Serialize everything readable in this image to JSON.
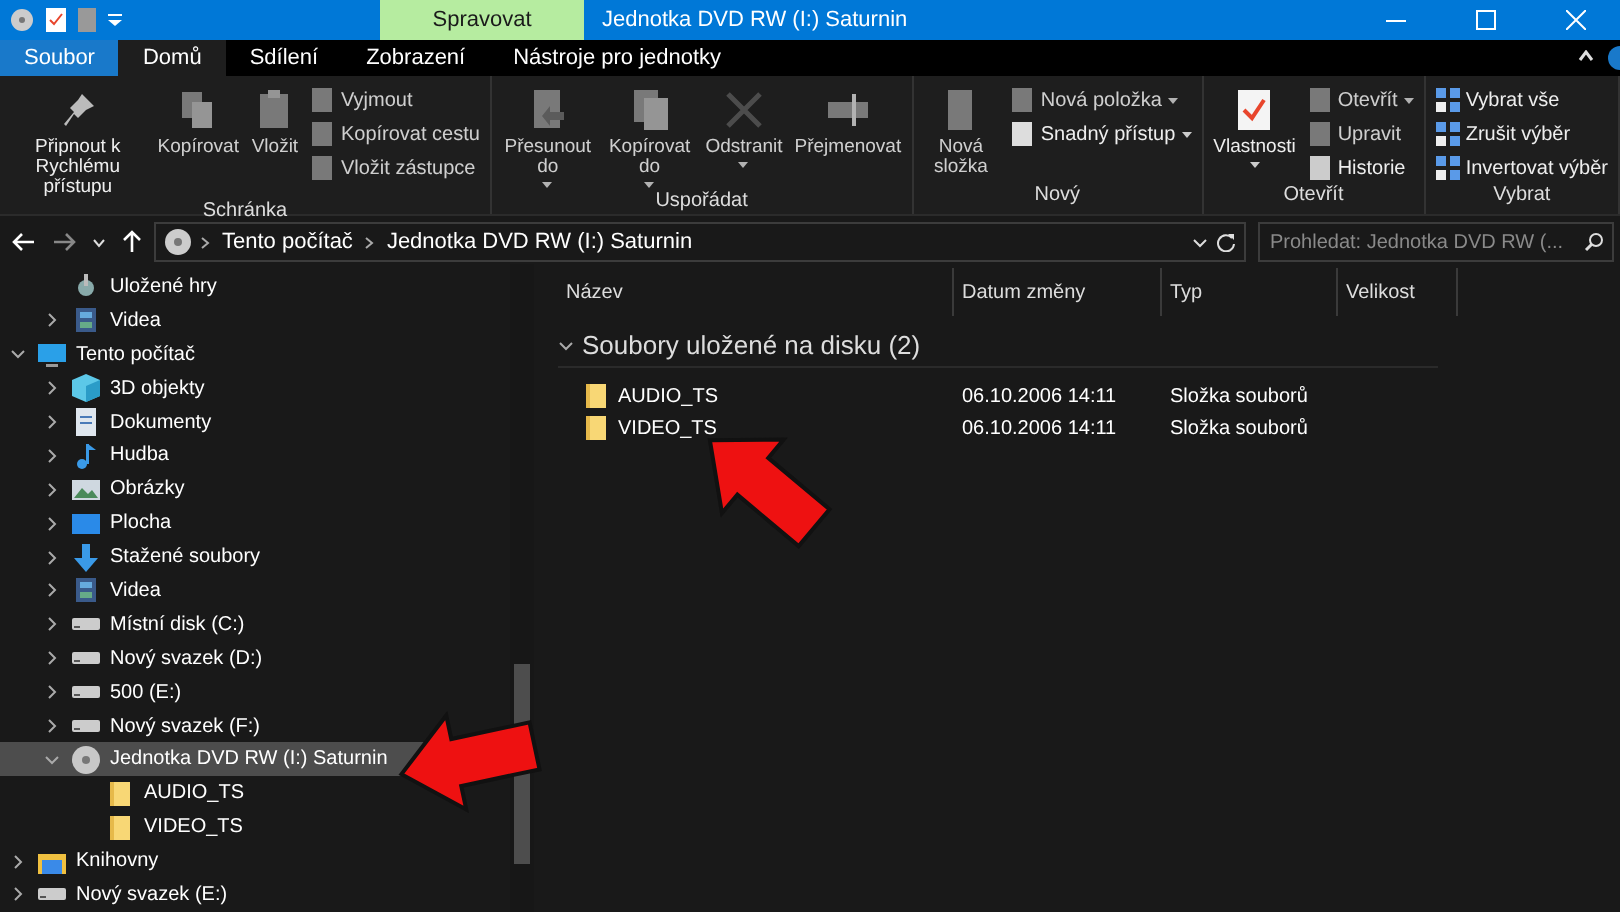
{
  "title_bar": {
    "context_tab": "Spravovat",
    "title": "Jednotka DVD RW (I:) Saturnin"
  },
  "ribbon_tabs": [
    {
      "label": "Soubor",
      "kind": "file",
      "selected": false
    },
    {
      "label": "Domů",
      "kind": "tab",
      "selected": true
    },
    {
      "label": "Sdílení",
      "kind": "tab",
      "selected": false
    },
    {
      "label": "Zobrazení",
      "kind": "tab",
      "selected": false
    },
    {
      "label": "Nástroje pro jednotky",
      "kind": "tab",
      "selected": false
    }
  ],
  "ribbon_groups": [
    {
      "label": "Schránka",
      "items": [
        {
          "kind": "large",
          "label": "Připnout k Rychlému přístupu",
          "disabled": false
        },
        {
          "kind": "large",
          "label": "Kopírovat",
          "disabled": true
        },
        {
          "kind": "large",
          "label": "Vložit",
          "disabled": true
        },
        {
          "kind": "stack",
          "items": [
            {
              "label": "Vyjmout",
              "disabled": true
            },
            {
              "label": "Kopírovat cestu",
              "disabled": true
            },
            {
              "label": "Vložit zástupce",
              "disabled": true
            }
          ]
        }
      ]
    },
    {
      "label": "Uspořádat",
      "items": [
        {
          "kind": "large",
          "label": "Přesunout do",
          "disabled": true,
          "menu": true
        },
        {
          "kind": "large",
          "label": "Kopírovat do",
          "disabled": true,
          "menu": true
        },
        {
          "kind": "large",
          "label": "Odstranit",
          "disabled": true,
          "menu": true
        },
        {
          "kind": "large",
          "label": "Přejmenovat",
          "disabled": true
        }
      ]
    },
    {
      "label": "Nový",
      "items": [
        {
          "kind": "large",
          "label": "Nová složka",
          "disabled": true
        },
        {
          "kind": "stack",
          "items": [
            {
              "label": "Nová položka",
              "disabled": true,
              "menu": true
            },
            {
              "label": "Snadný přístup",
              "disabled": false,
              "menu": true
            }
          ]
        }
      ]
    },
    {
      "label": "Otevřít",
      "items": [
        {
          "kind": "large",
          "label": "Vlastnosti",
          "disabled": false,
          "menu": true
        },
        {
          "kind": "stack",
          "items": [
            {
              "label": "Otevřít",
              "disabled": true,
              "menu": true
            },
            {
              "label": "Upravit",
              "disabled": true
            },
            {
              "label": "Historie",
              "disabled": false
            }
          ]
        }
      ]
    },
    {
      "label": "Vybrat",
      "items": [
        {
          "kind": "stack",
          "items": [
            {
              "label": "Vybrat vše",
              "disabled": false
            },
            {
              "label": "Zrušit výběr",
              "disabled": false
            },
            {
              "label": "Invertovat výběr",
              "disabled": false
            }
          ]
        }
      ]
    }
  ],
  "address_bar": {
    "breadcrumbs": [
      "Tento počítač",
      "Jednotka DVD RW (I:) Saturnin"
    ],
    "search": {
      "placeholder": "Prohledat: Jednotka DVD RW (..."
    }
  },
  "navigation_pane": {
    "items": [
      {
        "label": "Uložené hry",
        "kind": "games",
        "expandable": false,
        "expanded": false,
        "selected": false
      },
      {
        "label": "Videa",
        "kind": "video",
        "expandable": true,
        "expanded": false,
        "selected": false
      }
    ],
    "tree": [
      {
        "label": "Tento počítač",
        "kind": "pc",
        "expandable": true,
        "expanded": true,
        "selected": false,
        "children": [
          {
            "label": "3D objekty",
            "kind": "cube",
            "expandable": true,
            "expanded": false,
            "selected": false
          },
          {
            "label": "Dokumenty",
            "kind": "doc",
            "expandable": true,
            "expanded": false,
            "selected": false
          },
          {
            "label": "Hudba",
            "kind": "music",
            "expandable": true,
            "expanded": false,
            "selected": false
          },
          {
            "label": "Obrázky",
            "kind": "image",
            "expandable": true,
            "expanded": false,
            "selected": false
          },
          {
            "label": "Plocha",
            "kind": "desktop",
            "expandable": true,
            "expanded": false,
            "selected": false
          },
          {
            "label": "Stažené soubory",
            "kind": "download",
            "expandable": true,
            "expanded": false,
            "selected": false
          },
          {
            "label": "Videa",
            "kind": "video",
            "expandable": true,
            "expanded": false,
            "selected": false
          },
          {
            "label": "Místní disk (C:)",
            "kind": "drive",
            "expandable": true,
            "expanded": false,
            "selected": false
          },
          {
            "label": "Nový svazek (D:)",
            "kind": "drive",
            "expandable": true,
            "expanded": false,
            "selected": false
          },
          {
            "label": "500 (E:)",
            "kind": "drive",
            "expandable": true,
            "expanded": false,
            "selected": false
          },
          {
            "label": "Nový svazek (F:)",
            "kind": "drive",
            "expandable": true,
            "expanded": false,
            "selected": false
          },
          {
            "label": "Jednotka DVD RW (I:) Saturnin",
            "kind": "disc",
            "expandable": true,
            "expanded": true,
            "selected": true,
            "children": [
              {
                "label": "AUDIO_TS",
                "kind": "folder",
                "expandable": false,
                "expanded": false,
                "selected": false
              },
              {
                "label": "VIDEO_TS",
                "kind": "folder",
                "expandable": false,
                "expanded": false,
                "selected": false
              }
            ]
          }
        ]
      },
      {
        "label": "Knihovny",
        "kind": "library",
        "expandable": true,
        "expanded": false,
        "selected": false
      },
      {
        "label": "Nový svazek (E:)",
        "kind": "drive",
        "expandable": true,
        "expanded": false,
        "selected": false
      }
    ]
  },
  "file_list": {
    "columns": [
      "Název",
      "Datum změny",
      "Typ",
      "Velikost"
    ],
    "group": {
      "label": "Soubory uložené na disku (2)",
      "expanded": true
    },
    "rows": [
      {
        "name": "AUDIO_TS",
        "date": "06.10.2006 14:11",
        "type": "Složka souborů"
      },
      {
        "name": "VIDEO_TS",
        "date": "06.10.2006 14:11",
        "type": "Složka souborů"
      }
    ]
  }
}
